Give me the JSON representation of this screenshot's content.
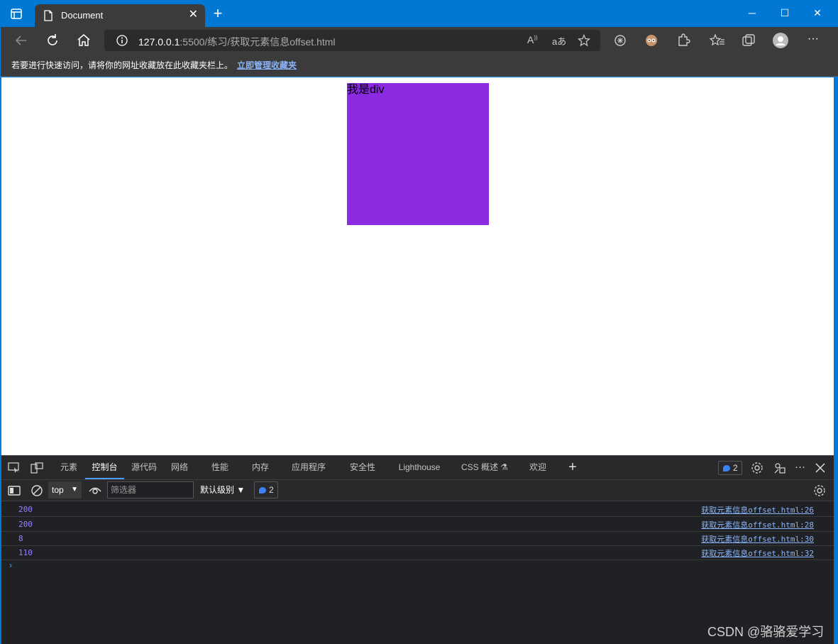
{
  "browser": {
    "tab_title": "Document",
    "tab_close": "✕",
    "new_tab": "+",
    "window_controls": {
      "minimize": "─",
      "maximize": "☐",
      "close": "✕"
    },
    "url_host": "127.0.0.1",
    "url_rest": ":5500/练习/获取元素信息offset.html",
    "favorites_hint": "若要进行快速访问，请将你的网址收藏放在此收藏夹栏上。",
    "favorites_link": "立即管理收藏夹",
    "theme_color": "#0078d4"
  },
  "page": {
    "box_text": "我是div",
    "box_color": "#8a2be2"
  },
  "devtools": {
    "tabs": [
      {
        "label": "元素"
      },
      {
        "label": "控制台"
      },
      {
        "label": "源代码"
      },
      {
        "label": "网络"
      },
      {
        "label": "性能"
      },
      {
        "label": "内存"
      },
      {
        "label": "应用程序"
      },
      {
        "label": "安全性"
      },
      {
        "label": "Lighthouse"
      },
      {
        "label": "CSS 概述 ⚗"
      },
      {
        "label": "欢迎"
      }
    ],
    "add_tab": "+",
    "issues_count": "2",
    "context": "top",
    "filter_placeholder": "筛选器",
    "levels": "默认级别 ▼",
    "messages_count": "2",
    "logs": [
      {
        "value": "200",
        "source": "获取元素信息offset.html:26"
      },
      {
        "value": "200",
        "source": "获取元素信息offset.html:28"
      },
      {
        "value": "8",
        "source": "获取元素信息offset.html:30"
      },
      {
        "value": "110",
        "source": "获取元素信息offset.html:32"
      }
    ],
    "prompt": "›"
  },
  "watermark": "CSDN @骆骆爱学习"
}
